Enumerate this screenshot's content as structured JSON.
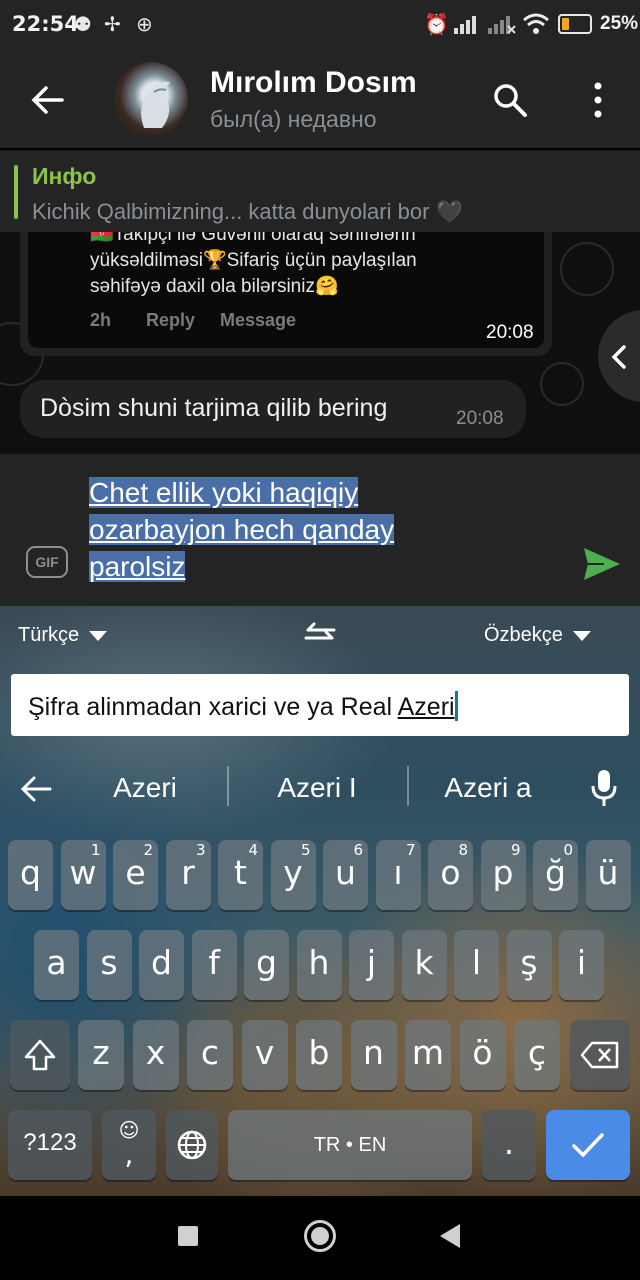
{
  "status_bar": {
    "time": "22:54",
    "battery_percent": "25%",
    "battery_level": 0.25
  },
  "header": {
    "contact_name": "Mırolım Dosım",
    "contact_status": "был(а) недавно"
  },
  "pinned": {
    "title": "Инфо",
    "text": "Kichik Qalbimizning... katta dunyolari bor 🖤"
  },
  "chat": {
    "forwarded": {
      "line1": "🇦🇿Takipçi ilə Güvənli olaraq səhifələrin",
      "line2": "yüksəldilməsi🏆Sifariş üçün paylaşılan",
      "line3": "səhifəyə daxil ola bilərsiniz🤗",
      "age": "2h",
      "reply_label": "Reply",
      "message_label": "Message",
      "time": "20:08"
    },
    "message": {
      "text": "Dòsim shuni tarjima qilib bering",
      "time": "20:08"
    }
  },
  "composer": {
    "line1": "Chet ellik yoki haqiqiy",
    "line2": "ozarbayjon hech qanday",
    "line3": "parolsiz",
    "gif_label": "GIF"
  },
  "keyboard": {
    "translate": {
      "from_lang": "Türkçe",
      "to_lang": "Özbekçe",
      "input_prefix": "Şifra alinmadan xarici ve ya Real ",
      "input_word": "Azeri"
    },
    "suggestions": [
      "Azeri",
      "Azeri I",
      "Azeri a"
    ],
    "row1": [
      {
        "k": "q",
        "s": ""
      },
      {
        "k": "w",
        "s": "1"
      },
      {
        "k": "e",
        "s": "2"
      },
      {
        "k": "r",
        "s": "3"
      },
      {
        "k": "t",
        "s": "4"
      },
      {
        "k": "y",
        "s": "5"
      },
      {
        "k": "u",
        "s": "6"
      },
      {
        "k": "ı",
        "s": "7"
      },
      {
        "k": "o",
        "s": "8"
      },
      {
        "k": "p",
        "s": "9"
      },
      {
        "k": "ğ",
        "s": "0"
      },
      {
        "k": "ü",
        "s": ""
      }
    ],
    "row2": [
      "a",
      "s",
      "d",
      "f",
      "g",
      "h",
      "j",
      "k",
      "l",
      "ş",
      "i"
    ],
    "row3": [
      "z",
      "x",
      "c",
      "v",
      "b",
      "n",
      "m",
      "ö",
      "ç"
    ],
    "key_123": "?123",
    "key_comma": ",",
    "key_space": "TR • EN",
    "key_period": "."
  },
  "colors": {
    "accent_green": "#8bc34a",
    "send_green": "#4caf50",
    "selection_blue": "#4a6fa8",
    "enter_blue": "#4a8be8"
  }
}
